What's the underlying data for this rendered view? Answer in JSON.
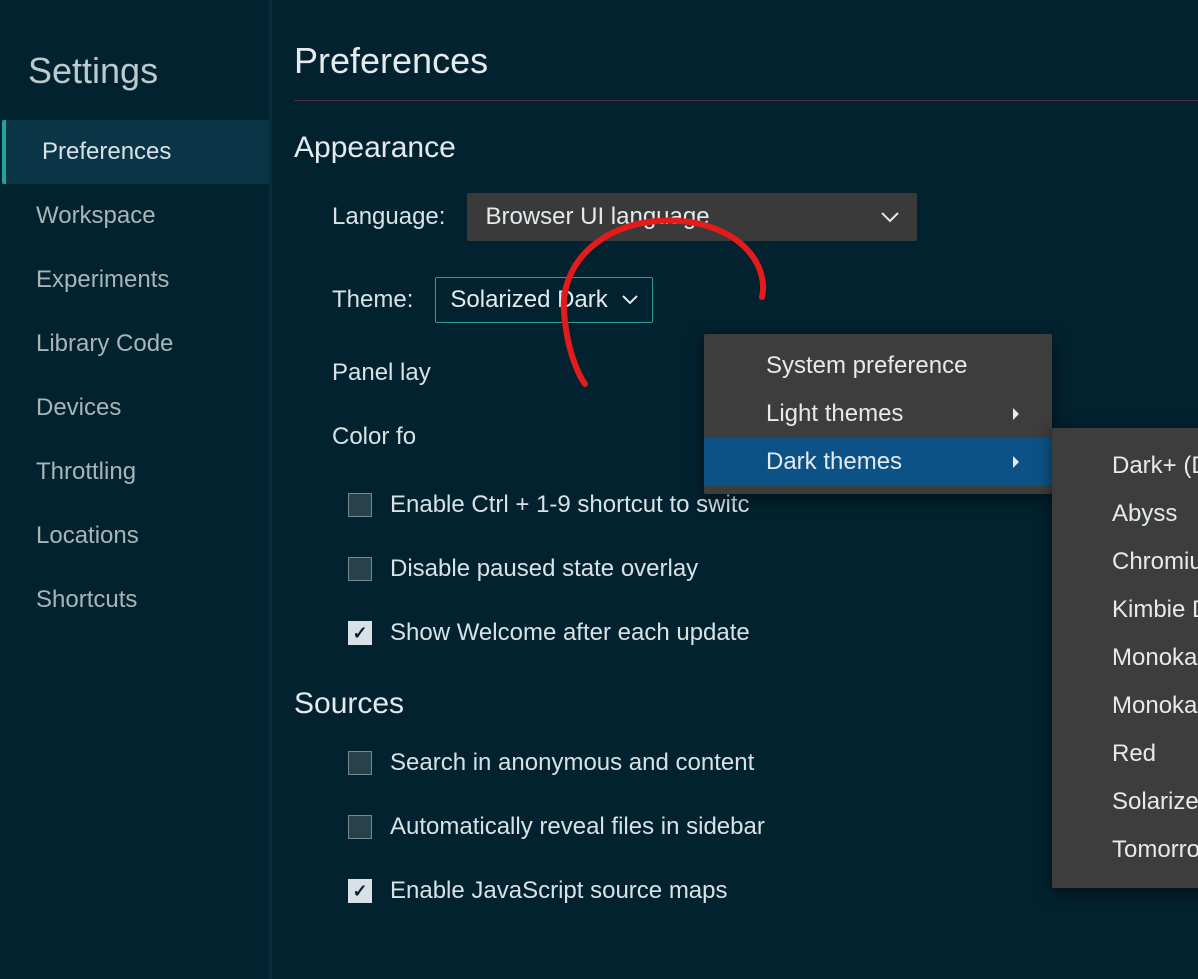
{
  "sidebar": {
    "title": "Settings",
    "items": [
      {
        "label": "Preferences",
        "active": true
      },
      {
        "label": "Workspace",
        "active": false
      },
      {
        "label": "Experiments",
        "active": false
      },
      {
        "label": "Library Code",
        "active": false
      },
      {
        "label": "Devices",
        "active": false
      },
      {
        "label": "Throttling",
        "active": false
      },
      {
        "label": "Locations",
        "active": false
      },
      {
        "label": "Shortcuts",
        "active": false
      }
    ]
  },
  "main": {
    "title": "Preferences",
    "appearance": {
      "title": "Appearance",
      "language_label": "Language:",
      "language_value": "Browser UI language",
      "theme_label": "Theme:",
      "theme_value": "Solarized Dark",
      "panel_layout_label": "Panel lay",
      "color_format_label": "Color fo",
      "checkboxes": [
        {
          "label": "Enable Ctrl + 1-9 shortcut to switc",
          "checked": false
        },
        {
          "label": "Disable paused state overlay",
          "checked": false
        },
        {
          "label": "Show Welcome after each update",
          "checked": true
        }
      ]
    },
    "sources": {
      "title": "Sources",
      "checkboxes": [
        {
          "label": "Search in anonymous and content",
          "checked": false
        },
        {
          "label": "Automatically reveal files in sidebar",
          "checked": false
        },
        {
          "label": "Enable JavaScript source maps",
          "checked": true
        }
      ]
    }
  },
  "theme_menu": {
    "items": [
      {
        "label": "System preference",
        "submenu": false,
        "highlight": false
      },
      {
        "label": "Light themes",
        "submenu": true,
        "highlight": false
      },
      {
        "label": "Dark themes",
        "submenu": true,
        "highlight": true
      }
    ]
  },
  "dark_themes_submenu": {
    "items": [
      "Dark+ (Default)",
      "Abyss",
      "Chromium Dark",
      "Kimbie Dark",
      "Monokai",
      "Monokai Dimmed",
      "Red",
      "Solarized Dark",
      "Tomorrow Night Blue"
    ]
  }
}
